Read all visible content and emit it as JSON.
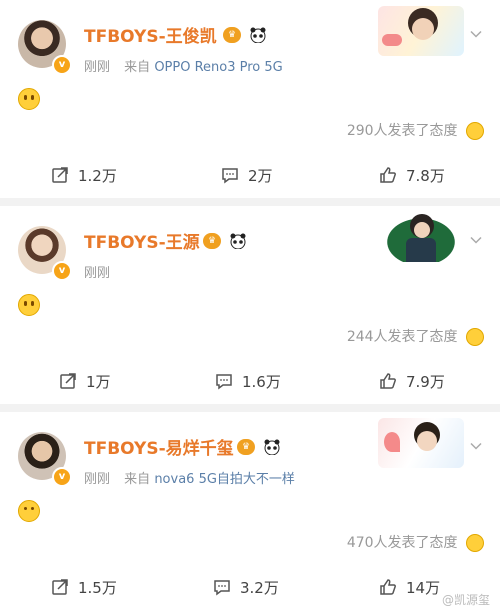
{
  "posts": [
    {
      "name": "TFBOYS-王俊凯",
      "time": "刚刚",
      "source_prefix": "来自",
      "device": "OPPO Reno3 Pro 5G",
      "attitude": "290人发表了态度",
      "actions": {
        "repost": "1.2万",
        "comment": "2万",
        "like": "7.8万"
      }
    },
    {
      "name": "TFBOYS-王源",
      "time": "刚刚",
      "attitude": "244人发表了态度",
      "actions": {
        "repost": "1万",
        "comment": "1.6万",
        "like": "7.9万"
      }
    },
    {
      "name": "TFBOYS-易烊千玺",
      "time": "刚刚",
      "source_prefix": "来自",
      "device": "nova6 5G自拍大不一样",
      "attitude": "470人发表了态度",
      "actions": {
        "repost": "1.5万",
        "comment": "3.2万",
        "like": "14万"
      }
    }
  ],
  "watermark": "@凯源玺",
  "colors": {
    "name": "#e8792a",
    "meta": "#999999",
    "device": "#5b7fa8",
    "badge": "#f7a418"
  },
  "icons": [
    "verified-badge",
    "vip-badge",
    "panda-emoji",
    "chevron-down-icon",
    "share-icon",
    "comment-icon",
    "like-icon",
    "smile-emoji"
  ]
}
